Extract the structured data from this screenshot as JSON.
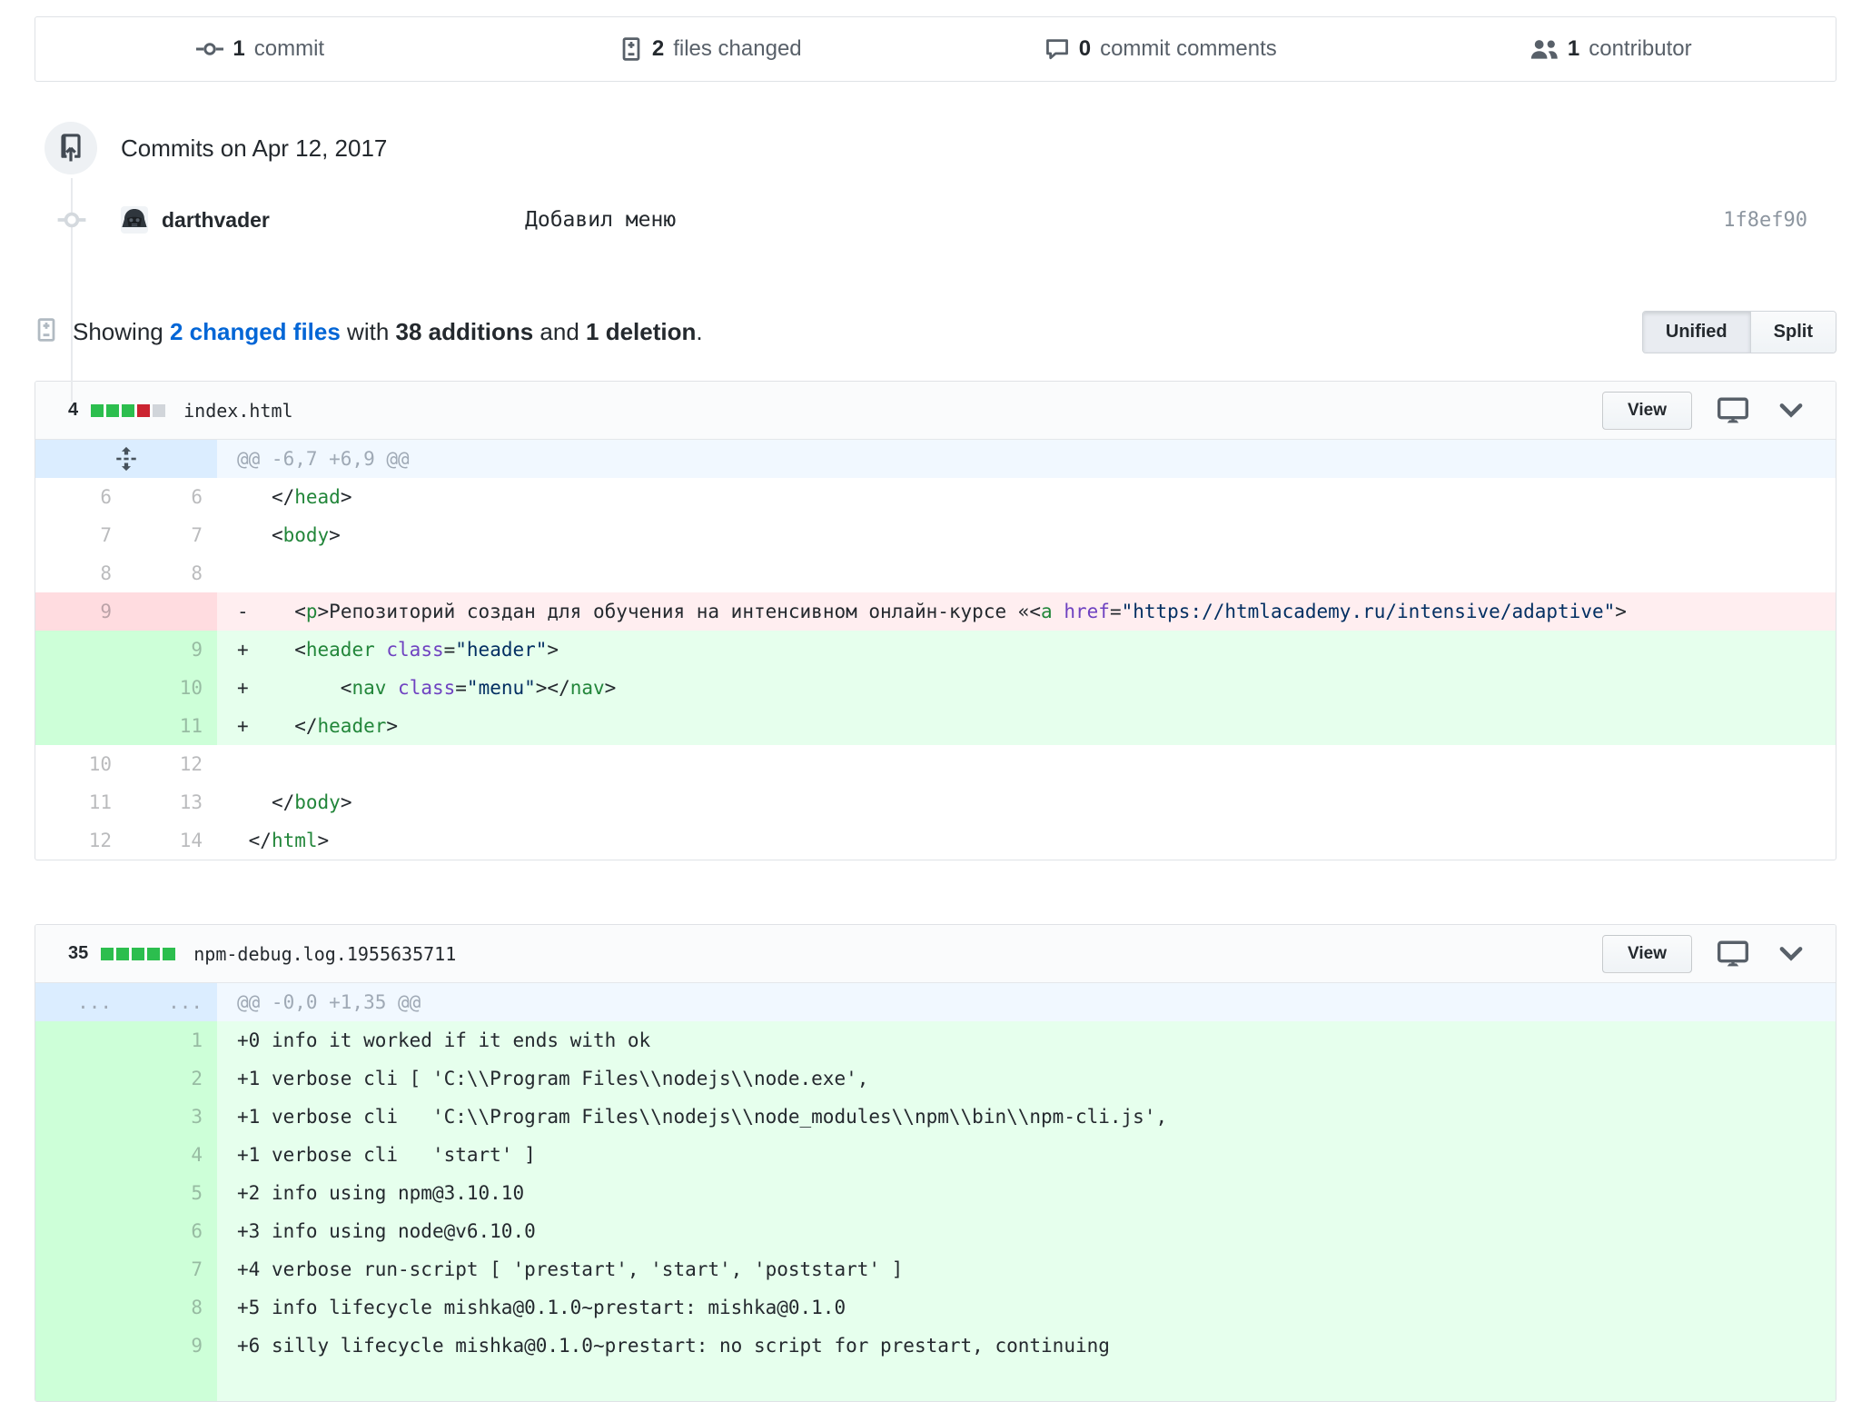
{
  "stats_bar": {
    "items": [
      {
        "icon": "git-commit-icon",
        "number": "1",
        "label": "commit"
      },
      {
        "icon": "file-diff-icon",
        "number": "2",
        "label": "files changed"
      },
      {
        "icon": "comment-icon",
        "number": "0",
        "label": "commit comments"
      },
      {
        "icon": "people-icon",
        "number": "1",
        "label": "contributor"
      }
    ]
  },
  "commits_section": {
    "date_heading": "Commits on Apr 12, 2017",
    "commit": {
      "author": "darthvader",
      "message": "Добавил меню",
      "hash": "1f8ef90"
    }
  },
  "toolbar": {
    "showing_prefix": "Showing ",
    "changed_files_link": "2 changed files",
    "with_text": " with ",
    "additions_text": "38 additions",
    "and_text": " and ",
    "deletion_text": "1 deletion",
    "period": ".",
    "unified_label": "Unified",
    "split_label": "Split"
  },
  "files": [
    {
      "changes": "4",
      "blocks": [
        "add",
        "add",
        "add",
        "del",
        "neutral"
      ],
      "filename": "index.html",
      "view_label": "View",
      "hunk": {
        "gutter": "unfold",
        "header": "@@ -6,7 +6,9 @@"
      },
      "filler": false,
      "rows": [
        {
          "type": "context",
          "old": "6",
          "new": "6",
          "sign": " ",
          "segs": [
            [
              "  </",
              ""
            ],
            [
              "head",
              "tag"
            ],
            [
              ">",
              ""
            ]
          ]
        },
        {
          "type": "context",
          "old": "7",
          "new": "7",
          "sign": " ",
          "segs": [
            [
              "  <",
              ""
            ],
            [
              "body",
              "tag"
            ],
            [
              ">",
              ""
            ]
          ]
        },
        {
          "type": "context",
          "old": "8",
          "new": "8",
          "sign": " ",
          "segs": []
        },
        {
          "type": "del",
          "old": "9",
          "new": "",
          "sign": "-",
          "segs": [
            [
              "    <",
              ""
            ],
            [
              "p",
              "tag"
            ],
            [
              ">Репозиторий создан для обучения на интенсивном онлайн-курсе «<",
              ""
            ],
            [
              "a",
              "tag"
            ],
            [
              " ",
              ""
            ],
            [
              "href",
              "attr"
            ],
            [
              "=",
              ""
            ],
            [
              "\"https://htmlacademy.ru/intensive/adaptive\"",
              "str"
            ],
            [
              ">",
              ""
            ]
          ]
        },
        {
          "type": "add",
          "old": "",
          "new": "9",
          "sign": "+",
          "segs": [
            [
              "    <",
              ""
            ],
            [
              "header",
              "tag"
            ],
            [
              " ",
              ""
            ],
            [
              "class",
              "attr"
            ],
            [
              "=",
              ""
            ],
            [
              "\"header\"",
              "str"
            ],
            [
              ">",
              ""
            ]
          ]
        },
        {
          "type": "add",
          "old": "",
          "new": "10",
          "sign": "+",
          "segs": [
            [
              "        <",
              ""
            ],
            [
              "nav",
              "tag"
            ],
            [
              " ",
              ""
            ],
            [
              "class",
              "attr"
            ],
            [
              "=",
              ""
            ],
            [
              "\"menu\"",
              "str"
            ],
            [
              "></",
              ""
            ],
            [
              "nav",
              "tag"
            ],
            [
              ">",
              ""
            ]
          ]
        },
        {
          "type": "add",
          "old": "",
          "new": "11",
          "sign": "+",
          "segs": [
            [
              "    </",
              ""
            ],
            [
              "header",
              "tag"
            ],
            [
              ">",
              ""
            ]
          ]
        },
        {
          "type": "context",
          "old": "10",
          "new": "12",
          "sign": " ",
          "segs": []
        },
        {
          "type": "context",
          "old": "11",
          "new": "13",
          "sign": " ",
          "segs": [
            [
              "  </",
              ""
            ],
            [
              "body",
              "tag"
            ],
            [
              ">",
              ""
            ]
          ]
        },
        {
          "type": "context",
          "old": "12",
          "new": "14",
          "sign": " ",
          "segs": [
            [
              "</",
              ""
            ],
            [
              "html",
              "tag"
            ],
            [
              ">",
              ""
            ]
          ]
        }
      ]
    },
    {
      "changes": "35",
      "blocks": [
        "add",
        "add",
        "add",
        "add",
        "add"
      ],
      "filename": "npm-debug.log.1955635711",
      "view_label": "View",
      "hunk": {
        "gutter": "dots",
        "header": "@@ -0,0 +1,35 @@"
      },
      "filler": true,
      "rows": [
        {
          "type": "add",
          "old": "",
          "new": "1",
          "sign": "+",
          "segs": [
            [
              "0 info it worked if it ends with ok",
              ""
            ]
          ]
        },
        {
          "type": "add",
          "old": "",
          "new": "2",
          "sign": "+",
          "segs": [
            [
              "1 verbose cli [ 'C:\\\\Program Files\\\\nodejs\\\\node.exe',",
              ""
            ]
          ]
        },
        {
          "type": "add",
          "old": "",
          "new": "3",
          "sign": "+",
          "segs": [
            [
              "1 verbose cli   'C:\\\\Program Files\\\\nodejs\\\\node_modules\\\\npm\\\\bin\\\\npm-cli.js',",
              ""
            ]
          ]
        },
        {
          "type": "add",
          "old": "",
          "new": "4",
          "sign": "+",
          "segs": [
            [
              "1 verbose cli   'start' ]",
              ""
            ]
          ]
        },
        {
          "type": "add",
          "old": "",
          "new": "5",
          "sign": "+",
          "segs": [
            [
              "2 info using npm@3.10.10",
              ""
            ]
          ]
        },
        {
          "type": "add",
          "old": "",
          "new": "6",
          "sign": "+",
          "segs": [
            [
              "3 info using node@v6.10.0",
              ""
            ]
          ]
        },
        {
          "type": "add",
          "old": "",
          "new": "7",
          "sign": "+",
          "segs": [
            [
              "4 verbose run-script [ 'prestart', 'start', 'poststart' ]",
              ""
            ]
          ]
        },
        {
          "type": "add",
          "old": "",
          "new": "8",
          "sign": "+",
          "segs": [
            [
              "5 info lifecycle mishka@0.1.0~prestart: mishka@0.1.0",
              ""
            ]
          ]
        },
        {
          "type": "add",
          "old": "",
          "new": "9",
          "sign": "+",
          "segs": [
            [
              "6 silly lifecycle mishka@0.1.0~prestart: no script for prestart, continuing",
              ""
            ]
          ]
        }
      ]
    }
  ],
  "colors": {
    "accent_link": "#0366d6",
    "addition_bg": "#e6ffed",
    "addition_gutter_bg": "#cdffd8",
    "deletion_bg": "#ffeef0",
    "deletion_gutter_bg": "#ffdce0",
    "hunk_bg": "#f1f8ff",
    "hunk_gutter_bg": "#dbedff",
    "diffstat_add": "#2cbe4e",
    "diffstat_del": "#cb2431",
    "diffstat_neutral": "#d1d5da",
    "syntax_tag": "#22863a",
    "syntax_attr": "#6f42c1",
    "syntax_string": "#032f62"
  }
}
